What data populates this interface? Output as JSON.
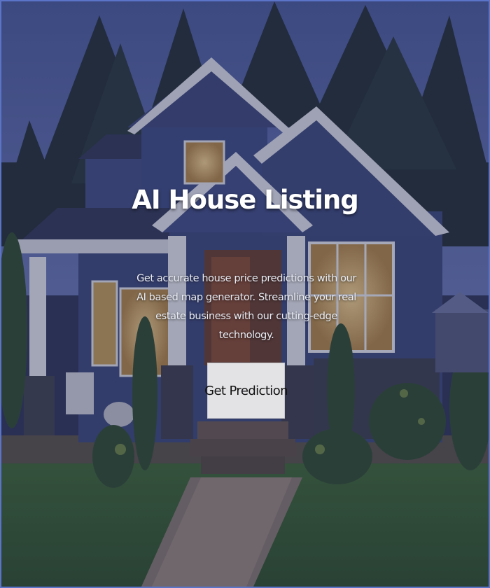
{
  "hero": {
    "title": "AI House Listing",
    "description": "Get accurate house price predictions with our AI based map generator. Streamline your real estate business with our cutting-edge technology.",
    "button_label": "Get Prediction",
    "background_image": "house-exterior-photo",
    "overlay_color": "#28305a"
  },
  "colors": {
    "frame": "#5b74c8",
    "button_bg": "#e3e3e6",
    "title_text": "#ffffff"
  }
}
